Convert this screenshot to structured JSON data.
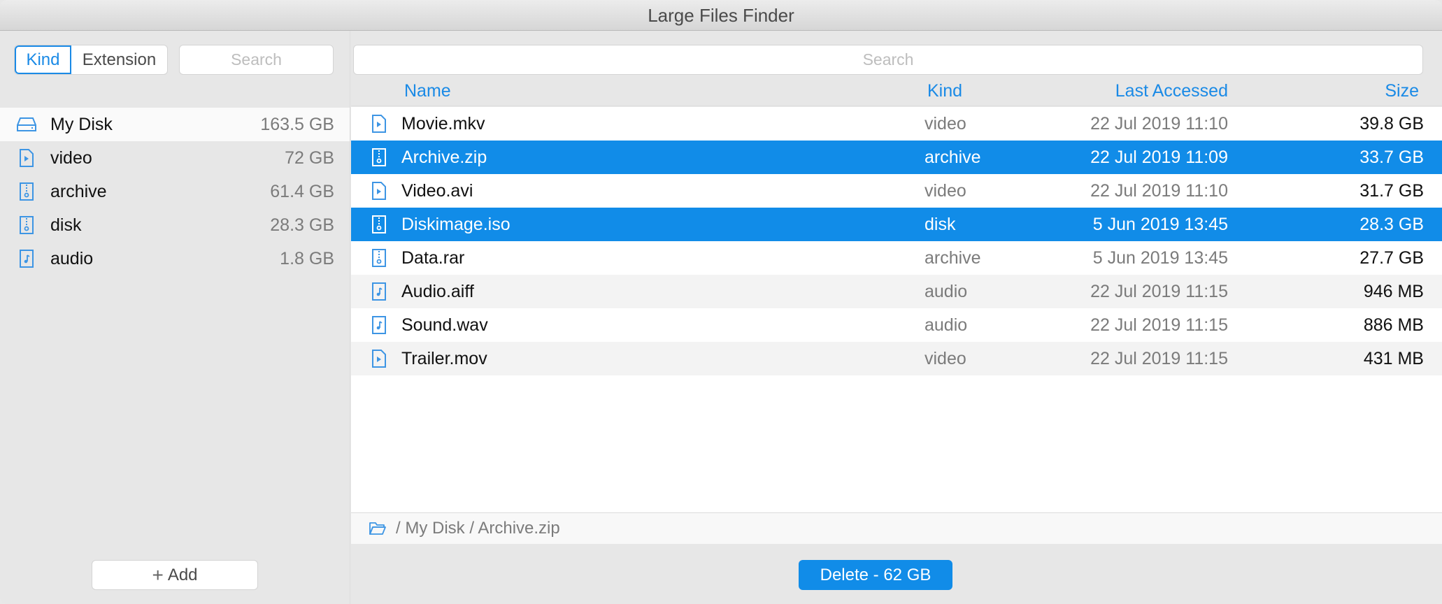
{
  "window": {
    "title": "Large Files Finder"
  },
  "colors": {
    "accent": "#118ce8",
    "header_text": "#1a8ae6",
    "icon": "#3d95e4"
  },
  "sidebar": {
    "segmented": {
      "options": [
        "Kind",
        "Extension"
      ],
      "selected": "Kind"
    },
    "search_placeholder": "Search",
    "items": [
      {
        "label": "My Disk",
        "size": "163.5 GB",
        "icon": "drive-icon",
        "selected": true
      },
      {
        "label": "video",
        "size": "72 GB",
        "icon": "video-file-icon"
      },
      {
        "label": "archive",
        "size": "61.4 GB",
        "icon": "archive-file-icon"
      },
      {
        "label": "disk",
        "size": "28.3 GB",
        "icon": "archive-file-icon"
      },
      {
        "label": "audio",
        "size": "1.8 GB",
        "icon": "audio-file-icon"
      }
    ],
    "add_button": {
      "icon": "plus-icon",
      "label": "Add"
    }
  },
  "main": {
    "search_placeholder": "Search",
    "columns": {
      "name": "Name",
      "kind": "Kind",
      "last_accessed": "Last Accessed",
      "size": "Size"
    },
    "rows": [
      {
        "name": "Movie.mkv",
        "kind": "video",
        "last_accessed": "22 Jul 2019 11:10",
        "size": "39.8 GB",
        "icon": "video-file-icon",
        "selected": false
      },
      {
        "name": "Archive.zip",
        "kind": "archive",
        "last_accessed": "22 Jul 2019 11:09",
        "size": "33.7 GB",
        "icon": "archive-file-icon",
        "selected": true
      },
      {
        "name": "Video.avi",
        "kind": "video",
        "last_accessed": "22 Jul 2019 11:10",
        "size": "31.7 GB",
        "icon": "video-file-icon",
        "selected": false
      },
      {
        "name": "Diskimage.iso",
        "kind": "disk",
        "last_accessed": "5 Jun 2019 13:45",
        "size": "28.3 GB",
        "icon": "archive-file-icon",
        "selected": true
      },
      {
        "name": "Data.rar",
        "kind": "archive",
        "last_accessed": "5 Jun 2019 13:45",
        "size": "27.7 GB",
        "icon": "archive-file-icon",
        "selected": false
      },
      {
        "name": "Audio.aiff",
        "kind": "audio",
        "last_accessed": "22 Jul 2019 11:15",
        "size": "946 MB",
        "icon": "audio-file-icon",
        "selected": false
      },
      {
        "name": "Sound.wav",
        "kind": "audio",
        "last_accessed": "22 Jul 2019 11:15",
        "size": "886 MB",
        "icon": "audio-file-icon",
        "selected": false
      },
      {
        "name": "Trailer.mov",
        "kind": "video",
        "last_accessed": "22 Jul 2019 11:15",
        "size": "431 MB",
        "icon": "video-file-icon",
        "selected": false
      }
    ],
    "breadcrumb": {
      "icon": "folder-icon",
      "path": "/ My Disk / Archive.zip"
    },
    "delete_button": "Delete - 62 GB"
  }
}
